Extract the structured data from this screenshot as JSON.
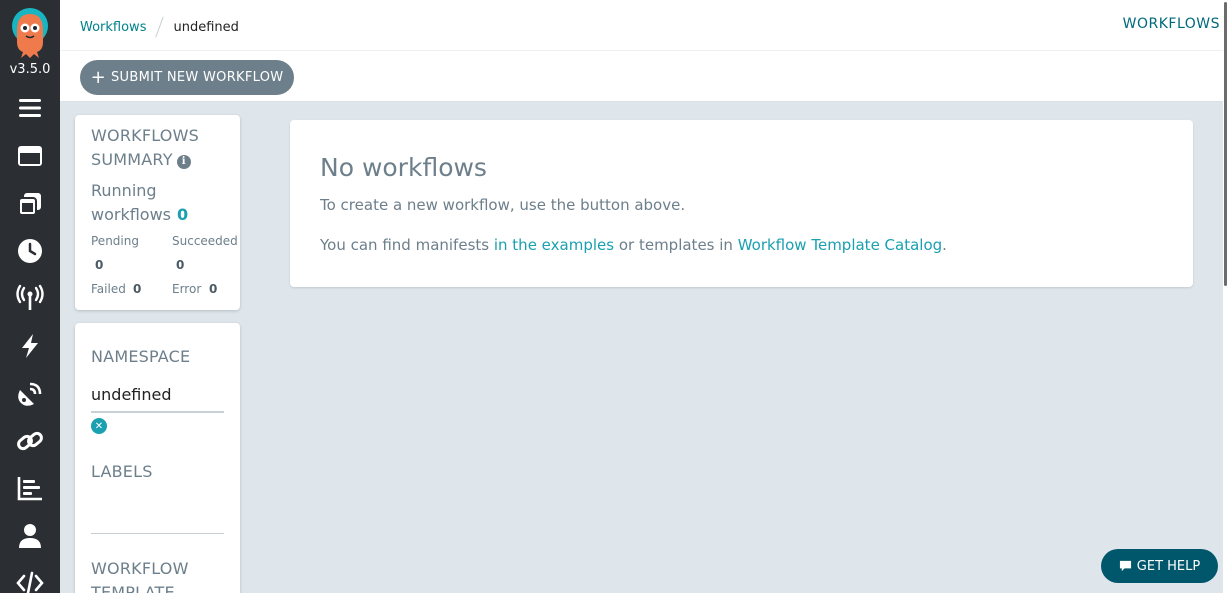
{
  "sidebar": {
    "version": "v3.5.0",
    "items": [
      {
        "icon": "bars-icon"
      },
      {
        "icon": "window-icon"
      },
      {
        "icon": "clone-icon"
      },
      {
        "icon": "clock-icon"
      },
      {
        "icon": "broadcast-tower-icon"
      },
      {
        "icon": "bolt-icon"
      },
      {
        "icon": "satellite-dish-icon"
      },
      {
        "icon": "link-icon"
      },
      {
        "icon": "chart-bar-icon"
      },
      {
        "icon": "user-icon"
      },
      {
        "icon": "code-icon"
      }
    ]
  },
  "header": {
    "breadcrumb_link": "Workflows",
    "breadcrumb_current": "undefined",
    "title": "WORKFLOWS",
    "submit_label": "SUBMIT NEW WORKFLOW"
  },
  "summary": {
    "heading_line1": "WORKFLOWS",
    "heading_line2": "SUMMARY",
    "running_line1": "Running",
    "running_line2": "workflows",
    "running_count": "0",
    "pending_label": "Pending",
    "pending_value": "0",
    "succeeded_label": "Succeeded",
    "succeeded_value": "0",
    "failed_label": "Failed",
    "failed_value": "0",
    "error_label": "Error",
    "error_value": "0"
  },
  "filters": {
    "namespace_heading": "NAMESPACE",
    "namespace_value": "undefined",
    "labels_heading": "LABELS",
    "template_heading_line1": "WORKFLOW",
    "template_heading_line2": "TEMPLATE"
  },
  "empty": {
    "title": "No workflows",
    "line1": "To create a new workflow, use the button above.",
    "line2_prefix": "You can find manifests ",
    "examples_link": "in the examples",
    "line2_middle": " or templates in ",
    "catalog_link": "Workflow Template Catalog",
    "line2_suffix": "."
  },
  "help": {
    "label": "GET HELP"
  },
  "colors": {
    "accent": "#1aa0b0",
    "sidebar": "#2b2f33",
    "help_button": "#00566b",
    "background": "#dee6eb"
  }
}
